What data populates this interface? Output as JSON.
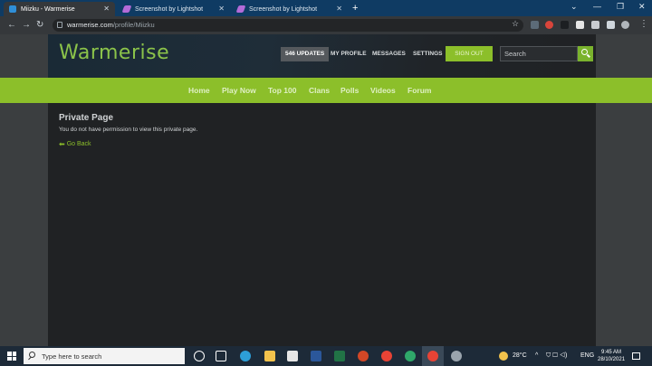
{
  "browser": {
    "tabs": [
      {
        "title": "Miizku - Warmerise",
        "active": true
      },
      {
        "title": "Screenshot by Lightshot",
        "active": false
      },
      {
        "title": "Screenshot by Lightshot",
        "active": false
      }
    ],
    "url_domain": "warmerise.com",
    "url_path": "/profile/Miizku"
  },
  "header": {
    "logo": "Warmerise",
    "updates": "546 UPDATES",
    "my_profile": "MY PROFILE",
    "messages": "MESSAGES",
    "settings": "SETTINGS",
    "sign_out": "SIGN OUT",
    "search_placeholder": "Search"
  },
  "nav": {
    "items": [
      "Home",
      "Play Now",
      "Top 100",
      "Clans",
      "Polls",
      "Videos",
      "Forum"
    ]
  },
  "content": {
    "title": "Private Page",
    "message": "You do not have permission to view this private page.",
    "go_back": "Go Back"
  },
  "taskbar": {
    "search_placeholder": "Type here to search",
    "weather": "28°C",
    "language": "ENG",
    "time": "9:45 AM",
    "date": "28/10/2021"
  },
  "colors": {
    "accent_green": "#8cbf2a",
    "content_bg": "#202224",
    "page_bg": "#3b3e40"
  }
}
